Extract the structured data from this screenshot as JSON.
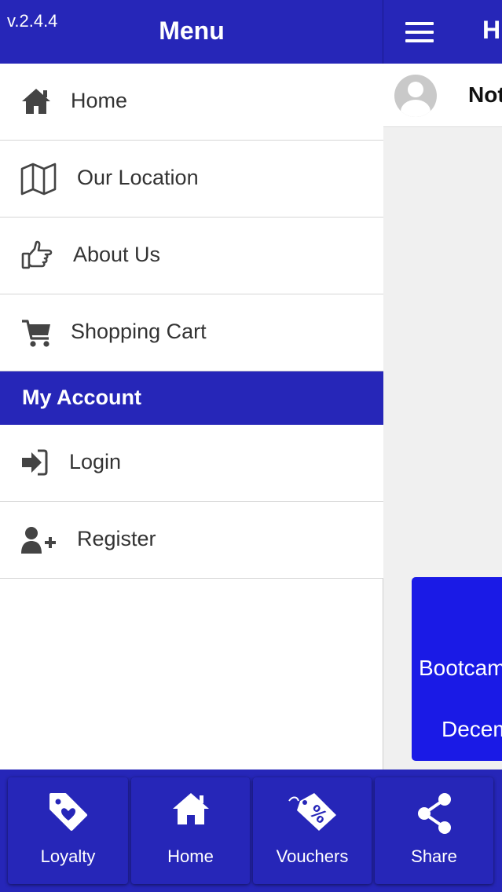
{
  "drawer": {
    "version": "v.2.4.4",
    "title": "Menu",
    "items": [
      {
        "label": "Home"
      },
      {
        "label": "Our Location"
      },
      {
        "label": "About Us"
      },
      {
        "label": "Shopping Cart"
      }
    ],
    "account_section": "My Account",
    "account_items": [
      {
        "label": "Login"
      },
      {
        "label": "Register"
      }
    ]
  },
  "main": {
    "title_partial": "H",
    "user_name_partial": "Not",
    "event_line1": "Bootcam",
    "event_line2": "Decem"
  },
  "bottom_nav": {
    "items": [
      {
        "label": "Loyalty",
        "icon": "heart-tag-icon"
      },
      {
        "label": "Home",
        "icon": "home-icon"
      },
      {
        "label": "Vouchers",
        "icon": "percent-tag-icon"
      },
      {
        "label": "Share",
        "icon": "share-icon"
      }
    ]
  },
  "colors": {
    "primary": "#2626b8",
    "event_card": "#1a1ae6",
    "icon_gray": "#444444"
  }
}
